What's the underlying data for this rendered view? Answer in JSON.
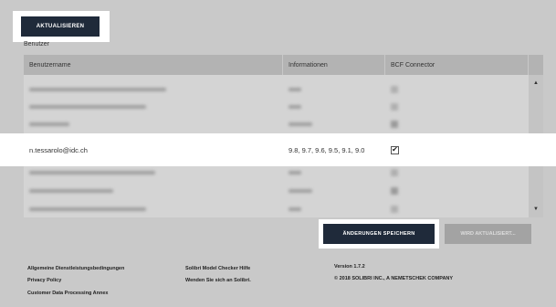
{
  "toolbar": {
    "refresh_label": "AKTUALISIEREN"
  },
  "section": {
    "users_label": "Benutzer"
  },
  "table": {
    "headers": [
      "Benutzername",
      "Informationen",
      "BCF Connector"
    ],
    "highlighted_row": {
      "username": "n.tessarolo@idc.ch",
      "info": "9.8, 9.7, 9.6, 9.5, 9.1, 9.0",
      "bcf_checked": true
    }
  },
  "actions": {
    "save_label": "ÄNDERUNGEN SPEICHERN",
    "pending_label": "WIRD AKTUALISIERT..."
  },
  "footer": {
    "terms": "Allgemeine Dienstleistungsbedingungen",
    "privacy": "Privacy Policy",
    "dpa": "Customer Data Processing Annex",
    "help": "Solibri Model Checker Hilfe",
    "contact": "Wenden Sie sich an Solibri.",
    "version": "Version 1.7.2",
    "copyright": "© 2018 SOLIBRI INC., A NEMETSCHEK COMPANY"
  },
  "icons": {
    "checkmark": "checkmark-icon",
    "scroll_up": "chevron-up-icon",
    "scroll_down": "chevron-down-icon"
  },
  "colors": {
    "primary_button": "#1f2a3a",
    "disabled_button": "#a3a3a3",
    "background": "#c9c9c9"
  }
}
